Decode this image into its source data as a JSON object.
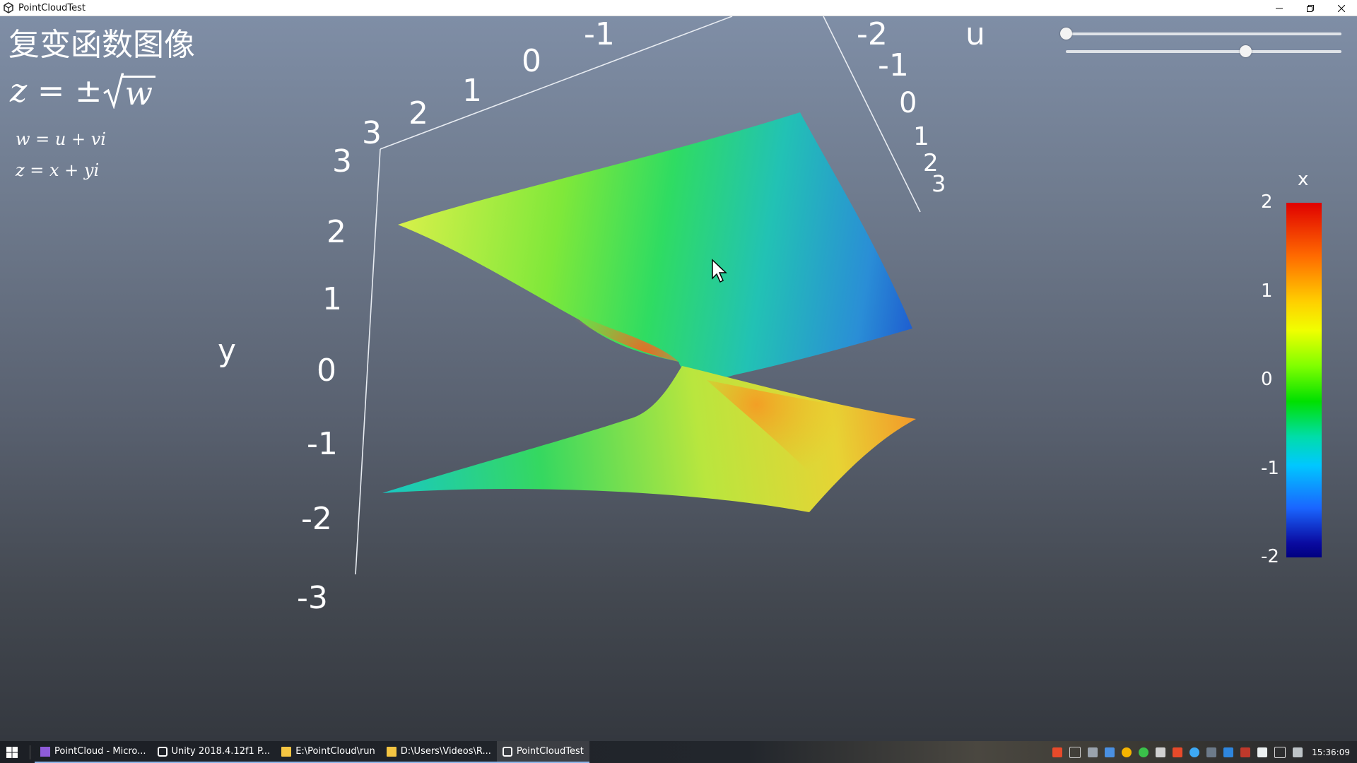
{
  "window": {
    "title": "PointCloudTest"
  },
  "overlay": {
    "title": "复变函数图像",
    "formula_lhs": "z = ±",
    "formula_radicand": "w",
    "formula_w": "w = u + vi",
    "formula_z": "z = x + yi"
  },
  "axes": {
    "y_label": "y",
    "y_ticks": [
      "3",
      "2",
      "1",
      "0",
      "-1",
      "-2",
      "-3"
    ],
    "top_ticks": [
      "3",
      "2",
      "1",
      "0",
      "-1"
    ],
    "u_label": "u",
    "u_ticks": [
      "-2",
      "-1",
      "0",
      "1",
      "2",
      "3"
    ]
  },
  "sliders": [
    {
      "name": "slider-1",
      "value": 0.0
    },
    {
      "name": "slider-2",
      "value": 0.65
    }
  ],
  "colorbar": {
    "label": "x",
    "ticks": [
      "2",
      "1",
      "0",
      "-1",
      "-2"
    ],
    "colors": [
      "#e00000",
      "#ff6a00",
      "#f0ff00",
      "#00e000",
      "#00c8ff",
      "#1a66ff",
      "#000080"
    ]
  },
  "taskbar": {
    "items": [
      {
        "label": "PointCloud - Micro...",
        "icon": "visual-studio-icon",
        "active": false
      },
      {
        "label": "Unity 2018.4.12f1 P...",
        "icon": "unity-icon",
        "active": false
      },
      {
        "label": "E:\\PointCloud\\run",
        "icon": "folder-icon",
        "active": false
      },
      {
        "label": "D:\\Users\\Videos\\R...",
        "icon": "folder-icon",
        "active": false
      },
      {
        "label": "PointCloudTest",
        "icon": "unity-icon",
        "active": true
      }
    ],
    "clock": "15:36:09"
  }
}
